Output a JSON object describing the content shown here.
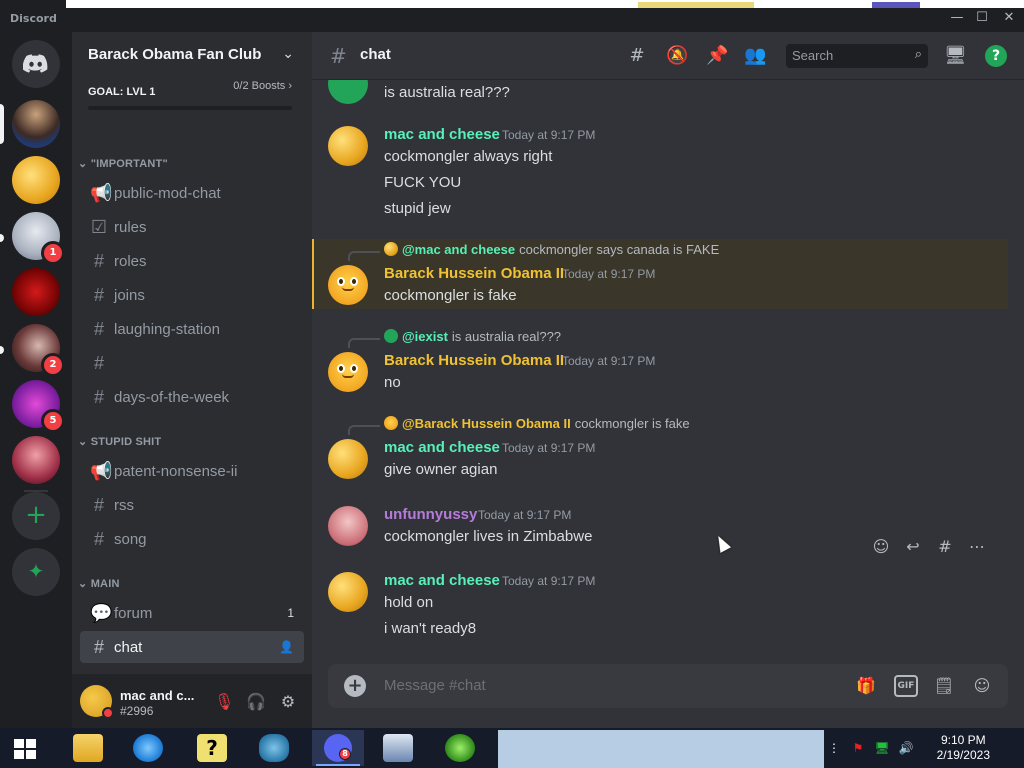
{
  "window": {
    "app_name": "Discord"
  },
  "guild": {
    "name": "Barack Obama Fan Club",
    "boost_goal": "GOAL: LVL 1",
    "boost_count": "0/2 Boosts",
    "boost_chevron": "›"
  },
  "rail": {
    "badges": [
      "1",
      "2",
      "5"
    ],
    "add_glyph": "+",
    "explore_glyph": "✦"
  },
  "categories": [
    {
      "name": "\"IMPORTANT\""
    },
    {
      "name": "STUPID SHIT"
    },
    {
      "name": "MAIN"
    }
  ],
  "channels": [
    {
      "name": "public-mod-chat",
      "icon": "announcement-icon"
    },
    {
      "name": "rules",
      "icon": "rules-icon"
    },
    {
      "name": "roles",
      "icon": "hash-icon"
    },
    {
      "name": "joins",
      "icon": "hash-icon"
    },
    {
      "name": "laughing-station",
      "icon": "hash-icon"
    },
    {
      "name": "",
      "icon": "hash-icon"
    },
    {
      "name": "days-of-the-week",
      "icon": "hash-icon"
    },
    {
      "name": "patent-nonsense-ii",
      "icon": "announcement-icon"
    },
    {
      "name": "rss",
      "icon": "hash-icon"
    },
    {
      "name": "song",
      "icon": "hash-icon"
    },
    {
      "name": "forum",
      "icon": "forum-icon",
      "count": "1"
    },
    {
      "name": "chat",
      "icon": "hash-icon"
    }
  ],
  "user": {
    "name": "mac and c...",
    "tag": "#2996"
  },
  "header": {
    "channel": "chat",
    "search_placeholder": "Search"
  },
  "messages": [
    {
      "author": "",
      "text": [
        "is australia real???"
      ]
    },
    {
      "author": "mac and cheese",
      "time": "Today at 9:17 PM",
      "color": "#57f0b8",
      "text": [
        "cockmongler always right",
        "FUCK YOU",
        "stupid jew"
      ]
    },
    {
      "author": "Barack Hussein Obama II",
      "time": "Today at 9:17 PM",
      "color": "#f0c232",
      "reply_to": "@mac and cheese",
      "reply_text": "cockmongler says canada is FAKE",
      "text": [
        "cockmongler is fake"
      ]
    },
    {
      "author": "Barack Hussein Obama II",
      "time": "Today at 9:17 PM",
      "color": "#f0c232",
      "reply_to": "@iexist",
      "reply_text": "is australia real???",
      "text": [
        "no"
      ]
    },
    {
      "author": "mac and cheese",
      "time": "Today at 9:17 PM",
      "color": "#57f0b8",
      "reply_to": "@Barack Hussein Obama II",
      "reply_text": "cockmongler is fake",
      "text": [
        "give owner agian"
      ]
    },
    {
      "author": "unfunnyussy",
      "time": "Today at 9:17 PM",
      "color": "#b47cd8",
      "text": [
        "cockmongler lives in Zimbabwe"
      ]
    },
    {
      "author": "mac and cheese",
      "time": "Today at 9:17 PM",
      "color": "#57f0b8",
      "text": [
        "hold on",
        "i wan't ready8"
      ]
    }
  ],
  "composer": {
    "placeholder": "Message #chat",
    "gif_label": "GIF"
  },
  "taskbar": {
    "discord_badge": "8",
    "time": "9:10 PM",
    "date": "2/19/2023"
  }
}
